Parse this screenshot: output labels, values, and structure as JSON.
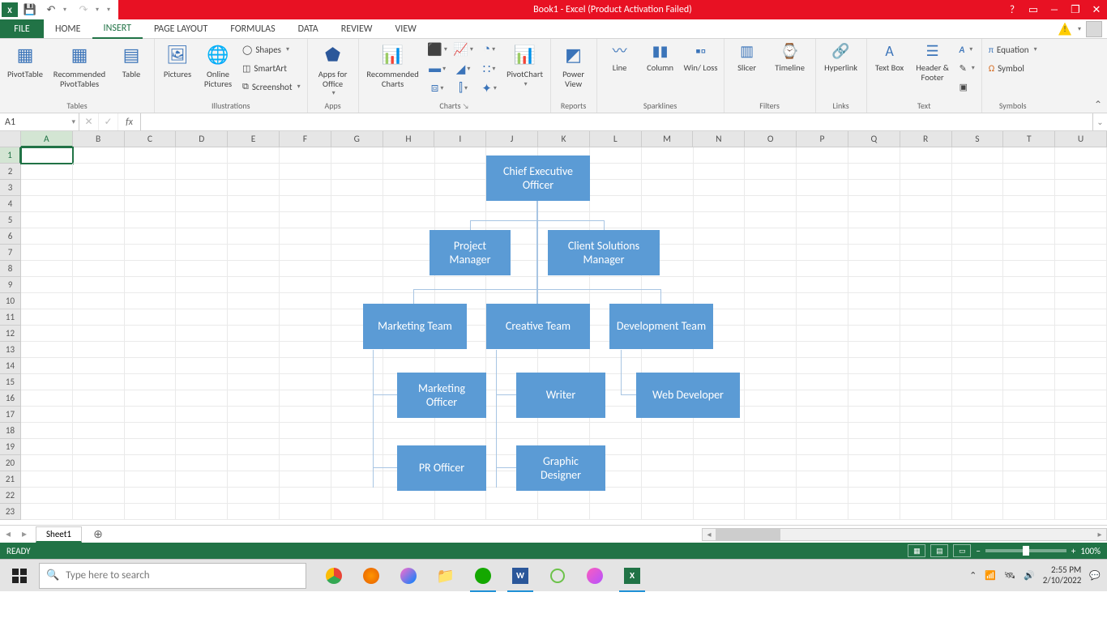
{
  "title": "Book1 - Excel (Product Activation Failed)",
  "qat": {
    "save": "💾",
    "undo": "↶",
    "redo": "↷"
  },
  "tabs": {
    "file": "FILE",
    "items": [
      "HOME",
      "INSERT",
      "PAGE LAYOUT",
      "FORMULAS",
      "DATA",
      "REVIEW",
      "VIEW"
    ],
    "active_index": 1
  },
  "ribbon": {
    "tables": {
      "label": "Tables",
      "pivot": "PivotTable",
      "recommended": "Recommended PivotTables",
      "table": "Table"
    },
    "illustrations": {
      "label": "Illustrations",
      "pictures": "Pictures",
      "online": "Online Pictures",
      "shapes": "Shapes",
      "smartart": "SmartArt",
      "screenshot": "Screenshot"
    },
    "apps": {
      "label": "Apps",
      "appsfor": "Apps for Office"
    },
    "charts": {
      "label": "Charts",
      "recommended": "Recommended Charts",
      "pivotchart": "PivotChart"
    },
    "reports": {
      "label": "Reports",
      "powerview": "Power View"
    },
    "sparklines": {
      "label": "Sparklines",
      "line": "Line",
      "column": "Column",
      "winloss": "Win/ Loss"
    },
    "filters": {
      "label": "Filters",
      "slicer": "Slicer",
      "timeline": "Timeline"
    },
    "links": {
      "label": "Links",
      "hyperlink": "Hyperlink"
    },
    "text": {
      "label": "Text",
      "textbox": "Text Box",
      "headerfooter": "Header & Footer"
    },
    "symbols": {
      "label": "Symbols",
      "equation": "Equation",
      "symbol": "Symbol"
    }
  },
  "namebox": "A1",
  "columns": [
    "A",
    "B",
    "C",
    "D",
    "E",
    "F",
    "G",
    "H",
    "I",
    "J",
    "K",
    "L",
    "M",
    "N",
    "O",
    "P",
    "Q",
    "R",
    "S",
    "T",
    "U"
  ],
  "rows": 23,
  "smartart": {
    "ceo": "Chief Executive Officer",
    "pm": "Project Manager",
    "csm": "Client Solutions Manager",
    "mkt_team": "Marketing Team",
    "crt_team": "Creative Team",
    "dev_team": "Development Team",
    "mkt_officer": "Marketing Officer",
    "writer": "Writer",
    "web_dev": "Web Developer",
    "pr": "PR Officer",
    "gd": "Graphic Designer"
  },
  "sheet": {
    "name": "Sheet1"
  },
  "status": {
    "ready": "READY",
    "zoom": "100%"
  },
  "taskbar": {
    "search_placeholder": "Type here to search",
    "time": "2:55 PM",
    "date": "2/10/2022"
  }
}
